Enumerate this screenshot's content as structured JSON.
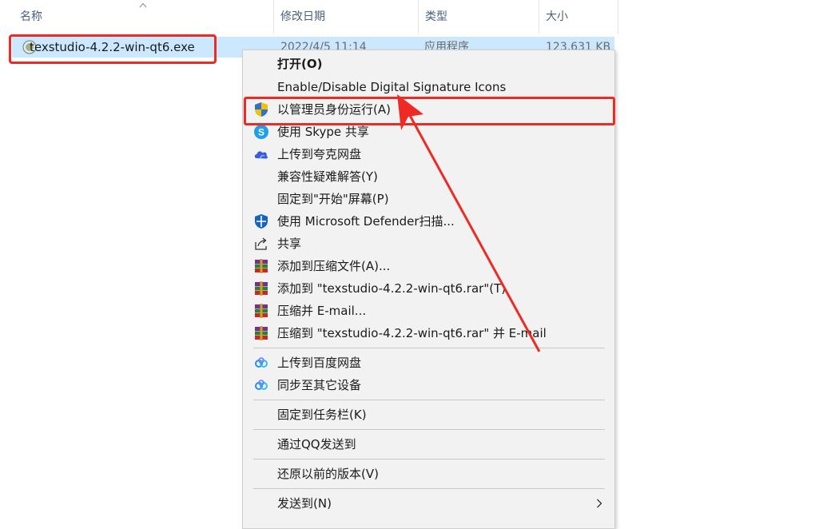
{
  "columns": {
    "name": "名称",
    "modified": "修改日期",
    "type": "类型",
    "size": "大小"
  },
  "file": {
    "name": "texstudio-4.2.2-win-qt6.exe",
    "modified": "2022/4/5 11:14",
    "type": "应用程序",
    "size": "123,631 KB"
  },
  "menu": {
    "open": "打开(O)",
    "digital_sig": "Enable/Disable Digital Signature Icons",
    "run_admin": "以管理员身份运行(A)",
    "skype_share": "使用 Skype 共享",
    "upload_quark": "上传到夸克网盘",
    "compat": "兼容性疑难解答(Y)",
    "pin_start": "固定到\"开始\"屏幕(P)",
    "defender": "使用 Microsoft Defender扫描...",
    "share": "共享",
    "add_archive": "添加到压缩文件(A)...",
    "add_rar": "添加到 \"texstudio-4.2.2-win-qt6.rar\"(T)",
    "compress_email": "压缩并 E-mail...",
    "compress_rar_email": "压缩到 \"texstudio-4.2.2-win-qt6.rar\" 并 E-mail",
    "upload_baidu": "上传到百度网盘",
    "sync_devices": "同步至其它设备",
    "pin_taskbar": "固定到任务栏(K)",
    "send_qq": "通过QQ发送到",
    "restore_prev": "还原以前的版本(V)",
    "send_to": "发送到(N)"
  },
  "colors": {
    "highlight_red": "#ee2a24",
    "selection_blue": "#cce8ff",
    "menu_bg": "#f2f2f2"
  }
}
